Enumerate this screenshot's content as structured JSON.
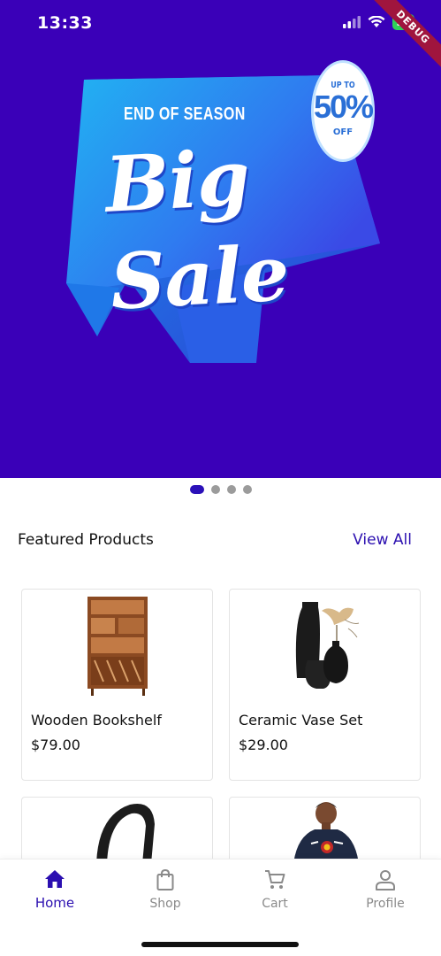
{
  "status_bar": {
    "time": "13:33",
    "battery": "94",
    "debug": "DEBUG",
    "icons": [
      "signal-icon",
      "wifi-icon",
      "battery-icon"
    ]
  },
  "banner": {
    "line1": "END OF SEASON",
    "headline": "Big Sale",
    "badge_up_to": "UP TO",
    "badge_percent": "50%",
    "badge_off": "OFF",
    "background_color": "#3a00b8"
  },
  "carousel": {
    "page_count": 4,
    "active_index": 0
  },
  "featured": {
    "title": "Featured Products",
    "view_all": "View All",
    "products": [
      {
        "name": "Wooden Bookshelf",
        "price": "$79.00",
        "image": "bookshelf"
      },
      {
        "name": "Ceramic Vase Set",
        "price": "$29.00",
        "image": "vase-set"
      },
      {
        "name": "",
        "price": "",
        "image": "headphones"
      },
      {
        "name": "",
        "price": "",
        "image": "hoodie"
      }
    ]
  },
  "tabs": [
    {
      "label": "Home",
      "icon": "home-icon",
      "active": true
    },
    {
      "label": "Shop",
      "icon": "shopping-bag-icon",
      "active": false
    },
    {
      "label": "Cart",
      "icon": "cart-icon",
      "active": false
    },
    {
      "label": "Profile",
      "icon": "profile-icon",
      "active": false
    }
  ],
  "colors": {
    "accent": "#2b0fb0",
    "inactive": "#8a8a8a"
  }
}
